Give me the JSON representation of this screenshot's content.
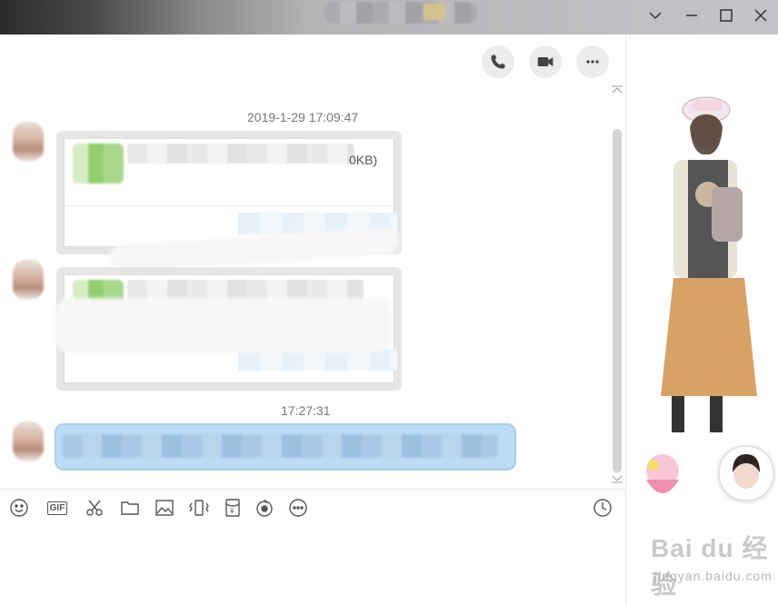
{
  "titlebar": {
    "controls": [
      "chevron-down",
      "minimize",
      "maximize",
      "close"
    ]
  },
  "header_actions": {
    "icons": [
      "phone-icon",
      "video-icon",
      "more-icon"
    ]
  },
  "messages": {
    "ts1": "2019-1-29 17:09:47",
    "file1_size": "0KB)",
    "ts2": "17:27:31"
  },
  "toolbar": {
    "gif_label": "GIF",
    "icons": [
      "emoji-icon",
      "gif-icon",
      "scissors-icon",
      "folder-icon",
      "image-icon",
      "shake-icon",
      "red-packet-icon",
      "voice-icon",
      "more-icon",
      "history-icon"
    ]
  },
  "watermark": {
    "brand": "Bai du 经验",
    "url": "jingyan.baidu.com"
  },
  "colors": {
    "bubble": "#bcdcf4",
    "titlebar": "#c4c4c8"
  }
}
